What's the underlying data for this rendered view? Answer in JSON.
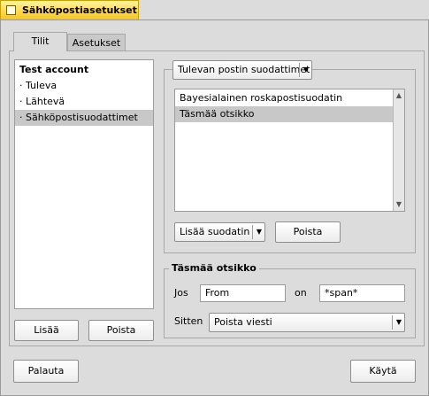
{
  "window": {
    "title": "Sähköpostiasetukset"
  },
  "tabs": [
    {
      "label": "Tilit",
      "active": true
    },
    {
      "label": "Asetukset",
      "active": false
    }
  ],
  "accounts": {
    "items": [
      {
        "label": "Test account",
        "kind": "header"
      },
      {
        "label": "· Tuleva"
      },
      {
        "label": "· Lähtevä"
      },
      {
        "label": "· Sähköpostisuodattimet",
        "selected": true
      }
    ],
    "add_button": "Lisää",
    "remove_button": "Poista"
  },
  "filters": {
    "type_selector": "Tulevan postin suodattimet",
    "items": [
      {
        "label": "Bayesialainen roskapostisuodatin"
      },
      {
        "label": "Täsmää otsikko",
        "selected": true
      }
    ],
    "add_filter_combo": "Lisää suodatin",
    "remove_button": "Poista"
  },
  "match_header": {
    "title": "Täsmää otsikko",
    "if_label": "Jos",
    "field_value": "From",
    "on_label": "on",
    "pattern_value": "*span*",
    "then_label": "Sitten",
    "action_value": "Poista viesti"
  },
  "footer": {
    "revert_button": "Palauta",
    "apply_button": "Käytä"
  },
  "colors": {
    "title_tab": "#ffd94a",
    "background": "#dcdcdc",
    "selection": "#c8c8c8"
  }
}
